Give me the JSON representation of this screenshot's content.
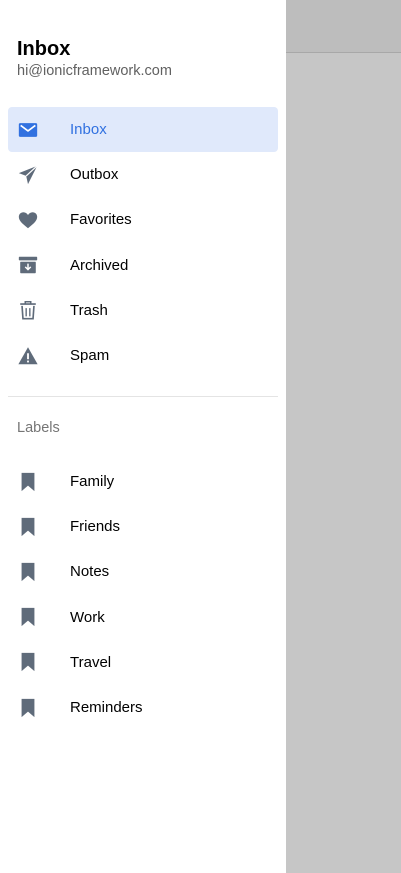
{
  "menu": {
    "title": "Inbox",
    "subtitle": "hi@ionicframework.com",
    "items": [
      {
        "label": "Inbox",
        "icon": "mail-icon",
        "active": true
      },
      {
        "label": "Outbox",
        "icon": "paper-plane-icon",
        "active": false
      },
      {
        "label": "Favorites",
        "icon": "heart-icon",
        "active": false
      },
      {
        "label": "Archived",
        "icon": "archive-icon",
        "active": false
      },
      {
        "label": "Trash",
        "icon": "trash-icon",
        "active": false
      },
      {
        "label": "Spam",
        "icon": "warning-icon",
        "active": false
      }
    ]
  },
  "labels": {
    "header": "Labels",
    "items": [
      {
        "label": "Family",
        "icon": "bookmark-icon"
      },
      {
        "label": "Friends",
        "icon": "bookmark-icon"
      },
      {
        "label": "Notes",
        "icon": "bookmark-icon"
      },
      {
        "label": "Work",
        "icon": "bookmark-icon"
      },
      {
        "label": "Travel",
        "icon": "bookmark-icon"
      },
      {
        "label": "Reminders",
        "icon": "bookmark-icon"
      }
    ]
  },
  "colors": {
    "accent": "#3171e0",
    "active_bg": "#e0e9fb",
    "icon": "#5f6b7a",
    "backdrop": "#c6c6c6"
  }
}
